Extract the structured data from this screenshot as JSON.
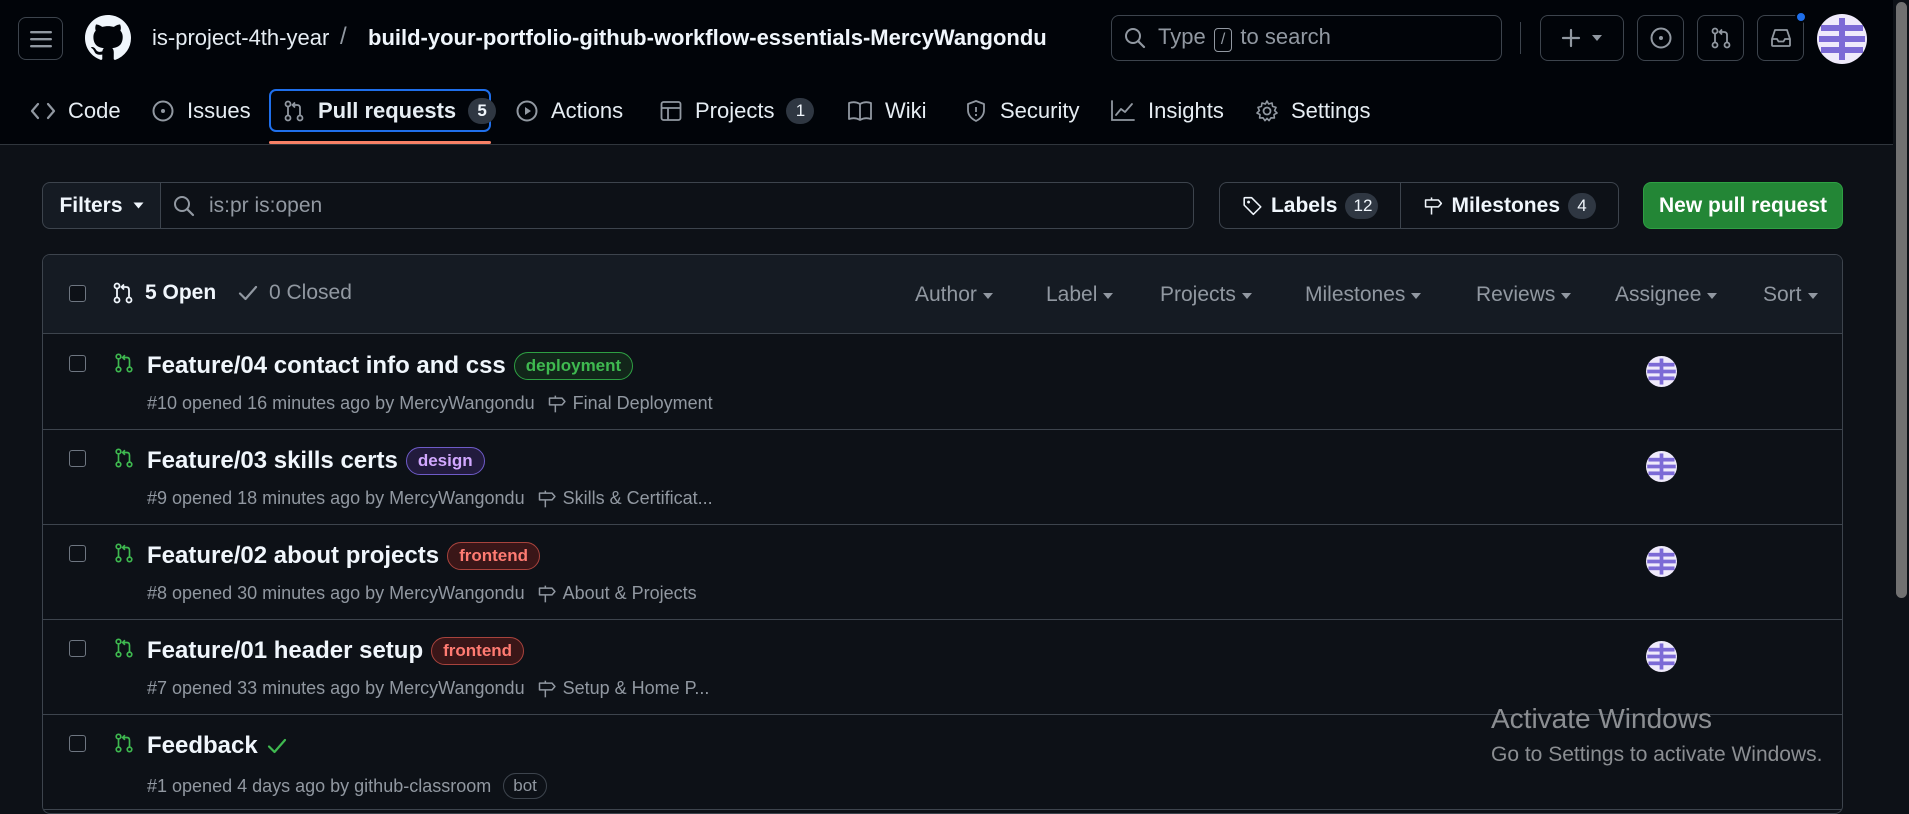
{
  "header": {
    "owner": "is-project-4th-year",
    "slash": "/",
    "repo": "build-your-portfolio-github-workflow-essentials-MercyWangondu",
    "search": {
      "prefix": "Type",
      "key": "/",
      "suffix": "to search"
    }
  },
  "tabs": [
    {
      "label": "Code",
      "icon": "code-icon"
    },
    {
      "label": "Issues",
      "icon": "issue-opened-icon"
    },
    {
      "label": "Pull requests",
      "icon": "git-pull-request-icon",
      "count": "5",
      "active": true
    },
    {
      "label": "Actions",
      "icon": "play-icon"
    },
    {
      "label": "Projects",
      "icon": "table-icon",
      "count": "1"
    },
    {
      "label": "Wiki",
      "icon": "book-icon"
    },
    {
      "label": "Security",
      "icon": "shield-icon"
    },
    {
      "label": "Insights",
      "icon": "graph-icon"
    },
    {
      "label": "Settings",
      "icon": "gear-icon"
    }
  ],
  "subnav": {
    "filters_label": "Filters",
    "filter_query": "is:pr is:open",
    "labels": {
      "label": "Labels",
      "count": "12"
    },
    "milestones": {
      "label": "Milestones",
      "count": "4"
    },
    "new_pr_label": "New pull request"
  },
  "list_header": {
    "open_label": "5 Open",
    "closed_label": "0 Closed",
    "filters": [
      "Author",
      "Label",
      "Projects",
      "Milestones",
      "Reviews",
      "Assignee",
      "Sort"
    ]
  },
  "pull_requests": [
    {
      "title": "Feature/04 contact info and css",
      "label": {
        "name": "deployment",
        "color": "#3fb950"
      },
      "meta": "#10 opened 16 minutes ago by MercyWangondu",
      "milestone": "Final Deployment"
    },
    {
      "title": "Feature/03 skills certs",
      "label": {
        "name": "design",
        "color": "#d2a8ff"
      },
      "meta": "#9 opened 18 minutes ago by MercyWangondu",
      "milestone": "Skills & Certificat..."
    },
    {
      "title": "Feature/02 about projects",
      "label": {
        "name": "frontend",
        "color": "#ff7b72"
      },
      "meta": "#8 opened 30 minutes ago by MercyWangondu",
      "milestone": "About & Projects"
    },
    {
      "title": "Feature/01 header setup",
      "label": {
        "name": "frontend",
        "color": "#ff7b72"
      },
      "meta": "#7 opened 33 minutes ago by MercyWangondu",
      "milestone": "Setup & Home P..."
    },
    {
      "title": "Feedback",
      "meta": "#1 opened 4 days ago by github-classroom",
      "badge": "bot"
    }
  ],
  "watermark": {
    "line1": "Activate Windows",
    "line2": "Go to Settings to activate Windows."
  },
  "colors": {
    "background": "#0d1117",
    "header_bg": "#010409",
    "accent_blue": "#1f6feb",
    "open_green": "#3fb950",
    "primary_button": "#238636",
    "tab_underline": "#f78166"
  }
}
